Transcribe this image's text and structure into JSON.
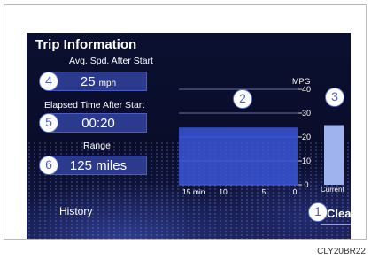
{
  "title": "Trip Information",
  "avg_speed": {
    "label": "Avg. Spd. After Start",
    "value": "25",
    "unit": "mph"
  },
  "elapsed": {
    "label": "Elapsed Time After Start",
    "value": "00:20"
  },
  "range": {
    "label": "Range",
    "value": "125 miles"
  },
  "history_label": "History",
  "clear_label": "Clear",
  "callouts": [
    "1",
    "2",
    "3",
    "4",
    "5",
    "6"
  ],
  "graph": {
    "unit_label": "MPG",
    "y_ticks": [
      "40",
      "30",
      "20",
      "10",
      "0"
    ],
    "x_ticks": [
      "15 min",
      "10",
      "5",
      "0"
    ],
    "current_label": "Current",
    "history_mpg": 24,
    "current_mpg": 25
  },
  "footer_code": "CLY20BR22",
  "colors": {
    "bar": "#3b56d8",
    "current_bar": "#9fb3ee",
    "background": "#0a0d2a",
    "accent": "#4a5fc8"
  }
}
